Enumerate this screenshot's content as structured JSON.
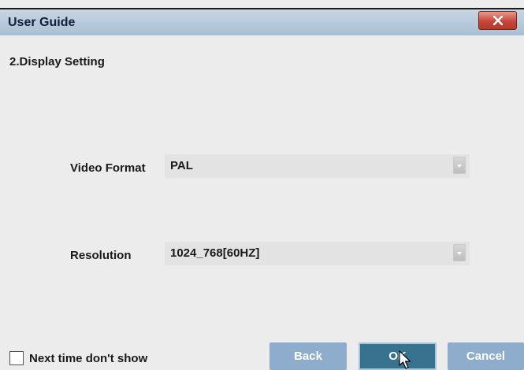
{
  "window": {
    "title": "User Guide"
  },
  "section": {
    "title": "2.Display Setting"
  },
  "fields": {
    "video_format": {
      "label": "Video Format",
      "value": "PAL"
    },
    "resolution": {
      "label": "Resolution",
      "value": "1024_768[60HZ]"
    }
  },
  "footer": {
    "checkbox_label": "Next time don't show",
    "back_label": "Back",
    "ok_label": "OK",
    "cancel_label": "Cancel"
  },
  "icons": {
    "close": "close-icon",
    "dropdown": "chevron-down-icon",
    "cursor": "mouse-cursor-icon"
  },
  "colors": {
    "titlebar": "#b7c9db",
    "close_button": "#c8473a",
    "button": "#8eaccc",
    "button_focused": "#37728f",
    "background": "#ececec"
  }
}
